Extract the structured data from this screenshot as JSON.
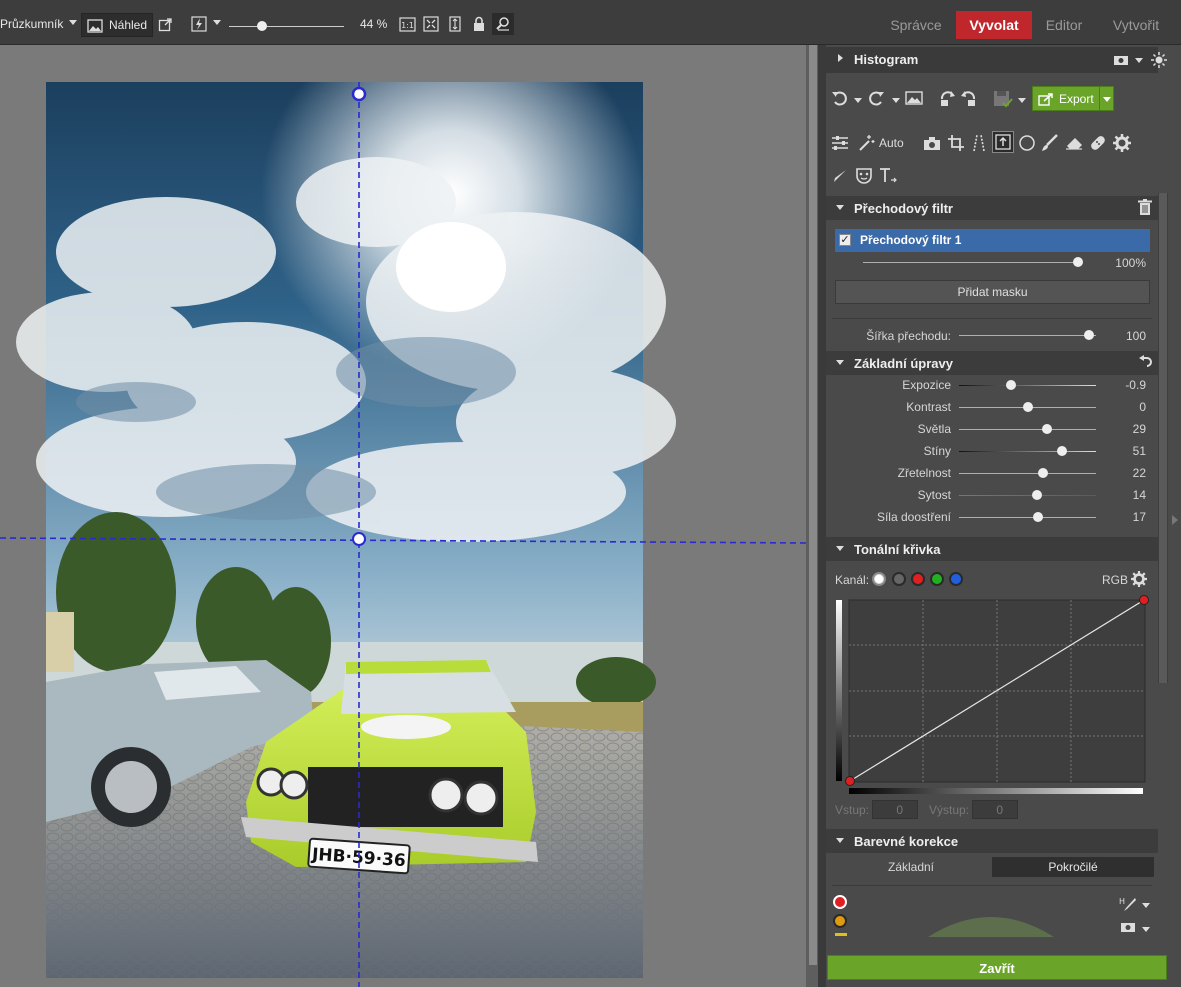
{
  "toolbar": {
    "explorer_label": "Průzkumník",
    "preview_label": "Náhled",
    "zoom_value": "44 %",
    "zoom_level": 0.44,
    "one_to_one": "1:1"
  },
  "modes": {
    "manager": "Správce",
    "develop": "Vyvolat",
    "editor": "Editor",
    "create": "Vytvořit"
  },
  "panel": {
    "histogram_title": "Histogram",
    "export_label": "Export",
    "auto_label": "Auto",
    "gradient_section_title": "Přechodový filtr",
    "gradient_item_label": "Přechodový filtr 1",
    "gradient_opacity": "100%",
    "add_mask_label": "Přidat masku",
    "transition_width_label": "Šířka přechodu:",
    "transition_width_value": "100",
    "basic_title": "Základní úpravy",
    "basic": [
      {
        "label": "Expozice",
        "value": "-0.9",
        "pos": 0.38
      },
      {
        "label": "Kontrast",
        "value": "0",
        "pos": 0.5
      },
      {
        "label": "Světla",
        "value": "29",
        "pos": 0.64
      },
      {
        "label": "Stíny",
        "value": "51",
        "pos": 0.75
      },
      {
        "label": "Zřetelnost",
        "value": "22",
        "pos": 0.61
      },
      {
        "label": "Sytost",
        "value": "14",
        "pos": 0.57
      },
      {
        "label": "Síla doostření",
        "value": "17",
        "pos": 0.58
      }
    ],
    "curve_title": "Tonální křivka",
    "channel_label": "Kanál:",
    "channel_value": "RGB",
    "input_label": "Vstup:",
    "input_value": "0",
    "output_label": "Výstup:",
    "output_value": "0",
    "color_title": "Barevné korekce",
    "color_tab_basic": "Základní",
    "color_tab_advanced": "Pokročilé",
    "close_label": "Zavřít"
  },
  "photo": {
    "license_plate": "JHB·59·36"
  },
  "colors": {
    "accent_red": "#c0272d",
    "selected_blue": "#3a6aa8",
    "close_green": "#6aa52a",
    "guide_blue": "#2a2ad0",
    "car_green": "#b8dc3a"
  }
}
